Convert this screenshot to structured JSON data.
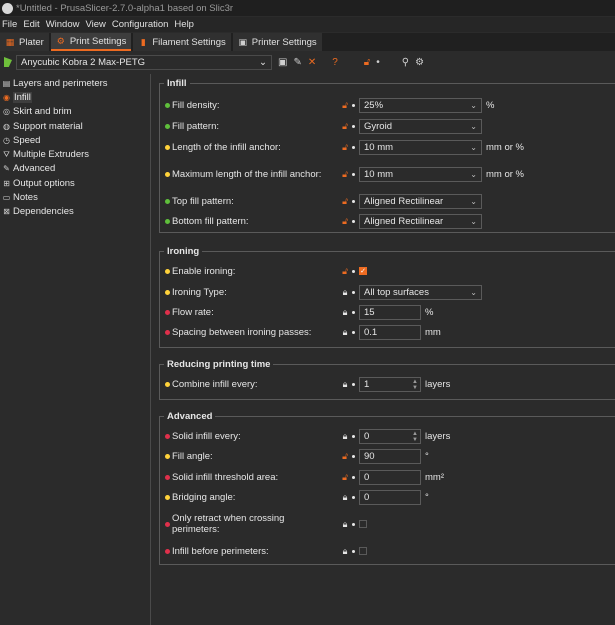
{
  "window": {
    "title": "*Untitled - PrusaSlicer-2.7.0-alpha1 based on Slic3r"
  },
  "menu": [
    "File",
    "Edit",
    "Window",
    "View",
    "Configuration",
    "Help"
  ],
  "tabs": [
    {
      "label": "Plater",
      "icon": "plater-icon"
    },
    {
      "label": "Print Settings",
      "icon": "gear-icon",
      "active": true
    },
    {
      "label": "Filament Settings",
      "icon": "spool-icon"
    },
    {
      "label": "Printer Settings",
      "icon": "printer-icon"
    }
  ],
  "preset": {
    "value": "Anycubic Kobra 2 Max-PETG"
  },
  "sidebar": {
    "items": [
      {
        "label": "Layers and perimeters",
        "icon": "layers-icon"
      },
      {
        "label": "Infill",
        "icon": "infill-icon",
        "selected": true
      },
      {
        "label": "Skirt and brim",
        "icon": "skirt-icon"
      },
      {
        "label": "Support material",
        "icon": "support-icon"
      },
      {
        "label": "Speed",
        "icon": "speed-icon"
      },
      {
        "label": "Multiple Extruders",
        "icon": "extruder-icon"
      },
      {
        "label": "Advanced",
        "icon": "advanced-icon"
      },
      {
        "label": "Output options",
        "icon": "output-icon"
      },
      {
        "label": "Notes",
        "icon": "notes-icon"
      },
      {
        "label": "Dependencies",
        "icon": "dependencies-icon"
      }
    ]
  },
  "infill": {
    "title": "Infill",
    "fill_density": {
      "label": "Fill density:",
      "value": "25%",
      "unit": "%"
    },
    "fill_pattern": {
      "label": "Fill pattern:",
      "value": "Gyroid"
    },
    "anchor": {
      "label": "Length of the infill anchor:",
      "value": "10 mm",
      "unit": "mm or %"
    },
    "anchor_max": {
      "label": "Maximum length of the infill anchor:",
      "value": "10 mm",
      "unit": "mm or %"
    },
    "top_pattern": {
      "label": "Top fill pattern:",
      "value": "Aligned Rectilinear"
    },
    "bottom_pattern": {
      "label": "Bottom fill pattern:",
      "value": "Aligned Rectilinear"
    }
  },
  "ironing": {
    "title": "Ironing",
    "enable": {
      "label": "Enable ironing:"
    },
    "type": {
      "label": "Ironing Type:",
      "value": "All top surfaces"
    },
    "flow": {
      "label": "Flow rate:",
      "value": "15",
      "unit": "%"
    },
    "spacing": {
      "label": "Spacing between ironing passes:",
      "value": "0.1",
      "unit": "mm"
    }
  },
  "reducing": {
    "title": "Reducing printing time",
    "combine": {
      "label": "Combine infill every:",
      "value": "1",
      "unit": "layers"
    }
  },
  "advanced": {
    "title": "Advanced",
    "solid_every": {
      "label": "Solid infill every:",
      "value": "0",
      "unit": "layers"
    },
    "fill_angle": {
      "label": "Fill angle:",
      "value": "90",
      "unit": "°"
    },
    "solid_threshold": {
      "label": "Solid infill threshold area:",
      "value": "0",
      "unit": "mm²"
    },
    "bridging_angle": {
      "label": "Bridging angle:",
      "value": "0",
      "unit": "°"
    },
    "only_retract": {
      "label_line1": "Only retract when crossing",
      "label_line2": "perimeters:"
    },
    "infill_first": {
      "label": "Infill before perimeters:"
    }
  }
}
